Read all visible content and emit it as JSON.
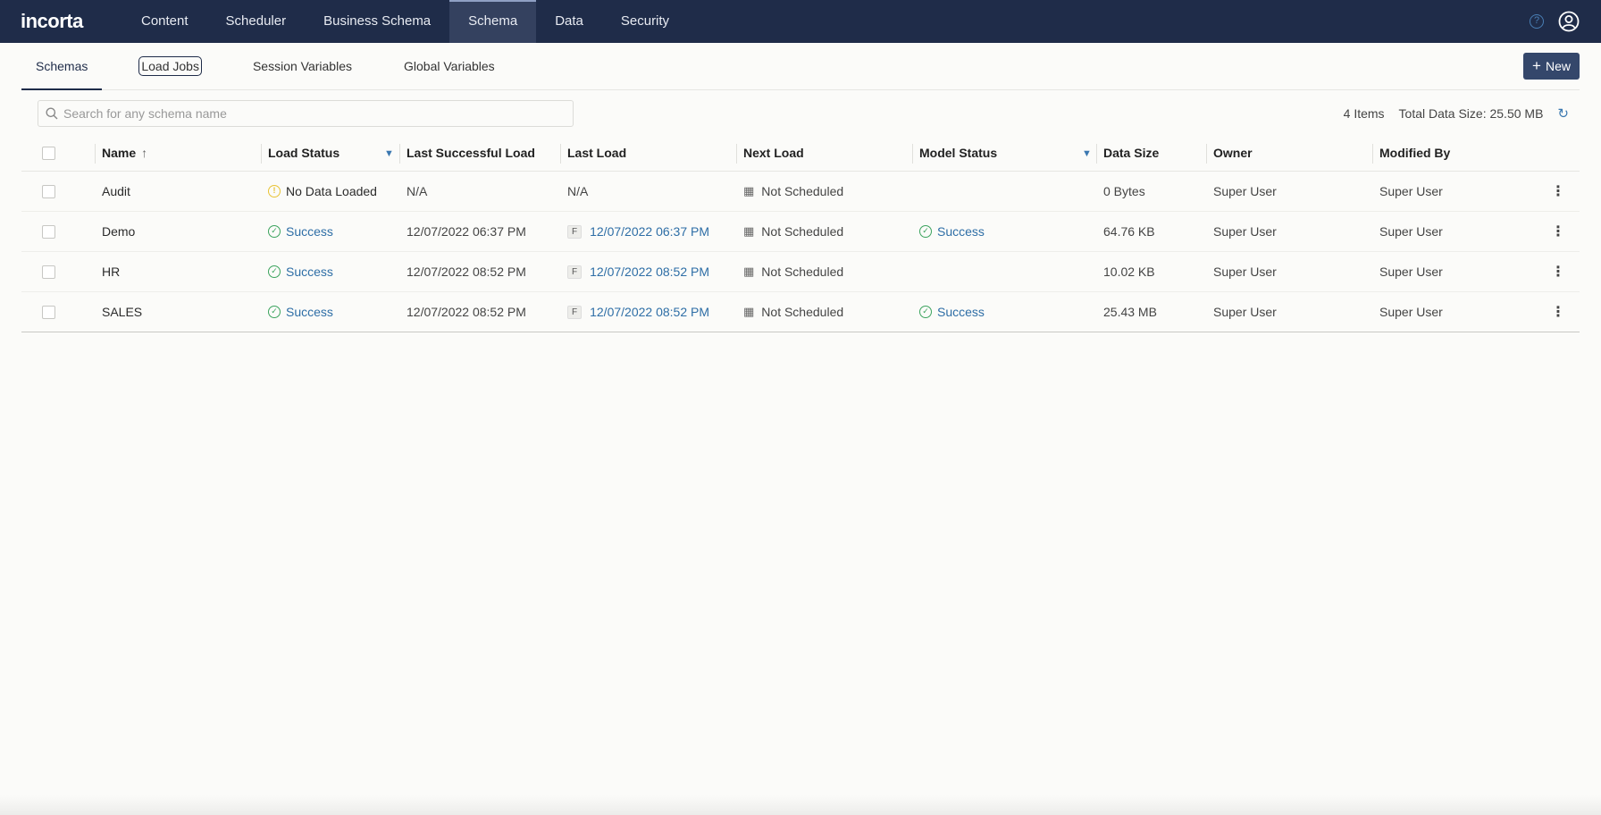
{
  "app": {
    "logo": "incorta"
  },
  "nav": {
    "items": [
      {
        "label": "Content"
      },
      {
        "label": "Scheduler"
      },
      {
        "label": "Business Schema"
      },
      {
        "label": "Schema",
        "active": true
      },
      {
        "label": "Data"
      },
      {
        "label": "Security"
      }
    ]
  },
  "subtabs": {
    "items": [
      {
        "label": "Schemas"
      },
      {
        "label": "Load Jobs"
      },
      {
        "label": "Session Variables"
      },
      {
        "label": "Global Variables"
      }
    ],
    "new_label": "New"
  },
  "search": {
    "placeholder": "Search for any schema name"
  },
  "summary": {
    "items": "4 Items",
    "total": "Total Data Size: 25.50 MB"
  },
  "table": {
    "columns": {
      "name": "Name",
      "load_status": "Load Status",
      "last_successful_load": "Last Successful Load",
      "last_load": "Last Load",
      "next_load": "Next Load",
      "model_status": "Model Status",
      "data_size": "Data Size",
      "owner": "Owner",
      "modified_by": "Modified By"
    },
    "rows": [
      {
        "name": "Audit",
        "load_status": "No Data Loaded",
        "last_successful_load": "N/A",
        "last_load": "N/A",
        "last_load_badge": "",
        "next_load": "Not Scheduled",
        "model_status": "",
        "data_size": "0 Bytes",
        "owner": "Super User",
        "modified_by": "Super User"
      },
      {
        "name": "Demo",
        "load_status": "Success",
        "last_successful_load": "12/07/2022 06:37 PM",
        "last_load": "12/07/2022 06:37 PM",
        "last_load_badge": "F",
        "next_load": "Not Scheduled",
        "model_status": "Success",
        "data_size": "64.76 KB",
        "owner": "Super User",
        "modified_by": "Super User"
      },
      {
        "name": "HR",
        "load_status": "Success",
        "last_successful_load": "12/07/2022 08:52 PM",
        "last_load": "12/07/2022 08:52 PM",
        "last_load_badge": "F",
        "next_load": "Not Scheduled",
        "model_status": "",
        "data_size": "10.02 KB",
        "owner": "Super User",
        "modified_by": "Super User"
      },
      {
        "name": "SALES",
        "load_status": "Success",
        "last_successful_load": "12/07/2022 08:52 PM",
        "last_load": "12/07/2022 08:52 PM",
        "last_load_badge": "F",
        "next_load": "Not Scheduled",
        "model_status": "Success",
        "data_size": "25.43 MB",
        "owner": "Super User",
        "modified_by": "Super User"
      }
    ]
  }
}
